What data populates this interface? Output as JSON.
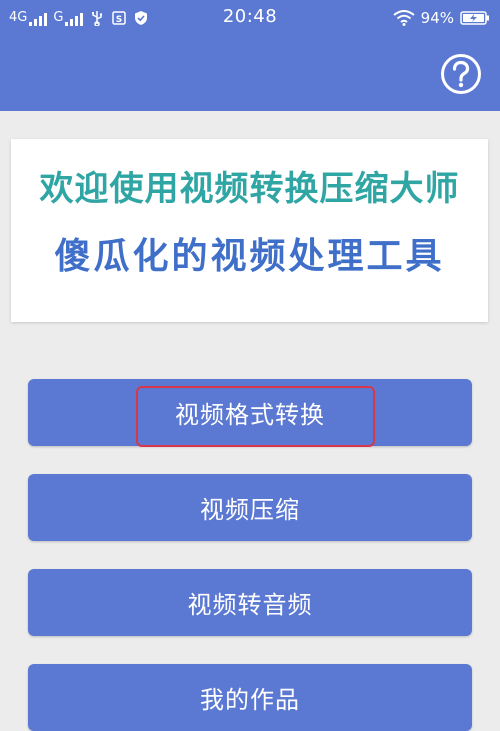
{
  "status_bar": {
    "network_1": "4G",
    "network_2": "G",
    "time": "20:48",
    "battery_percent": "94%",
    "icons": [
      "signal-bars-icon",
      "usb-icon",
      "sim-icon",
      "shield-icon",
      "wifi-icon",
      "battery-charging-icon"
    ]
  },
  "header": {
    "help_icon": "question-circle-icon"
  },
  "welcome": {
    "title": "欢迎使用视频转换压缩大师",
    "subtitle": "傻瓜化的视频处理工具"
  },
  "menu": {
    "items": [
      {
        "label": "视频格式转换"
      },
      {
        "label": "视频压缩"
      },
      {
        "label": "视频转音频"
      },
      {
        "label": "我的作品"
      }
    ]
  },
  "colors": {
    "primary": "#5b79d2",
    "title_teal": "#2fa5a4",
    "subtitle_blue": "#3f6fc8",
    "highlight_red": "#d8374a",
    "background": "#ececec"
  }
}
